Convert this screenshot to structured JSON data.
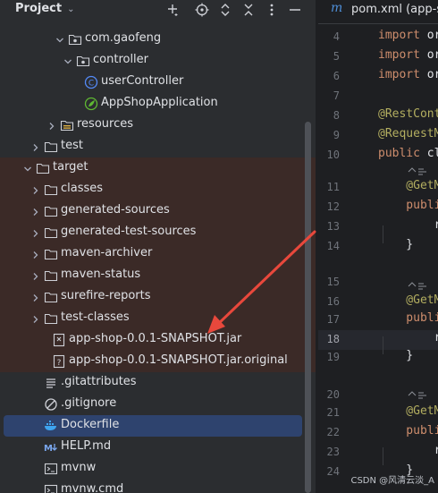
{
  "panel": {
    "title": "Project"
  },
  "tree": [
    {
      "label": "com.gaofeng",
      "type": "package",
      "arrow": "open"
    },
    {
      "label": "controller",
      "type": "package",
      "arrow": "open"
    },
    {
      "label": "userController",
      "type": "class",
      "arrow": "none"
    },
    {
      "label": "AppShopApplication",
      "type": "spring",
      "arrow": "none"
    },
    {
      "label": "resources",
      "type": "resources",
      "arrow": "closed"
    },
    {
      "label": "test",
      "type": "folder",
      "arrow": "closed"
    },
    {
      "label": "target",
      "type": "folder",
      "arrow": "open"
    },
    {
      "label": "classes",
      "type": "folder",
      "arrow": "closed"
    },
    {
      "label": "generated-sources",
      "type": "folder",
      "arrow": "closed"
    },
    {
      "label": "generated-test-sources",
      "type": "folder",
      "arrow": "closed"
    },
    {
      "label": "maven-archiver",
      "type": "folder",
      "arrow": "closed"
    },
    {
      "label": "maven-status",
      "type": "folder",
      "arrow": "closed"
    },
    {
      "label": "surefire-reports",
      "type": "folder",
      "arrow": "closed"
    },
    {
      "label": "test-classes",
      "type": "folder",
      "arrow": "closed"
    },
    {
      "label": "app-shop-0.0.1-SNAPSHOT.jar",
      "type": "jar",
      "arrow": "none"
    },
    {
      "label": "app-shop-0.0.1-SNAPSHOT.jar.original",
      "type": "unknown",
      "arrow": "none"
    },
    {
      "label": ".gitattributes",
      "type": "text",
      "arrow": "none"
    },
    {
      "label": ".gitignore",
      "type": "ignore",
      "arrow": "none"
    },
    {
      "label": "Dockerfile",
      "type": "docker",
      "arrow": "none"
    },
    {
      "label": "HELP.md",
      "type": "markdown",
      "arrow": "none"
    },
    {
      "label": "mvnw",
      "type": "terminal",
      "arrow": "none"
    },
    {
      "label": "mvnw.cmd",
      "type": "terminal",
      "arrow": "none"
    }
  ],
  "editor": {
    "tab_icon": "m",
    "tab_label": "pom.xml (app-sh",
    "lines": [
      {
        "n": "4",
        "segs": [
          [
            "kw",
            "import "
          ],
          [
            "",
            "or"
          ]
        ]
      },
      {
        "n": "5",
        "segs": [
          [
            "kw",
            "import "
          ],
          [
            "",
            "or"
          ]
        ]
      },
      {
        "n": "6",
        "segs": [
          [
            "kw",
            "import "
          ],
          [
            "",
            "or"
          ]
        ]
      },
      {
        "n": "7",
        "segs": []
      },
      {
        "n": "8",
        "segs": [
          [
            "ann",
            "@RestCont"
          ]
        ]
      },
      {
        "n": "9",
        "segs": [
          [
            "ann",
            "@RequestM"
          ]
        ]
      },
      {
        "n": "10",
        "segs": [
          [
            "kw",
            "public "
          ],
          [
            "",
            "cl"
          ]
        ]
      },
      {
        "n": "11",
        "segs": [
          [
            "ann",
            "    @GetM"
          ]
        ]
      },
      {
        "n": "12",
        "segs": [
          [
            "kw",
            "    publi"
          ]
        ]
      },
      {
        "n": "13",
        "segs": [
          [
            "",
            "        r"
          ]
        ]
      },
      {
        "n": "14",
        "segs": [
          [
            "",
            "    }"
          ]
        ]
      },
      {
        "n": "15",
        "segs": []
      },
      {
        "n": "16",
        "segs": [
          [
            "ann",
            "    @GetM"
          ]
        ]
      },
      {
        "n": "17",
        "segs": [
          [
            "kw",
            "    publi"
          ]
        ]
      },
      {
        "n": "18",
        "segs": [
          [
            "",
            "        r"
          ]
        ]
      },
      {
        "n": "19",
        "segs": [
          [
            "",
            "    }"
          ]
        ]
      },
      {
        "n": "20",
        "segs": []
      },
      {
        "n": "21",
        "segs": [
          [
            "ann",
            "    @GetM"
          ]
        ]
      },
      {
        "n": "22",
        "segs": [
          [
            "kw",
            "    publi"
          ]
        ]
      },
      {
        "n": "23",
        "segs": [
          [
            "",
            "        r"
          ]
        ]
      },
      {
        "n": "24",
        "segs": [
          [
            "",
            "    }"
          ]
        ]
      }
    ],
    "current_line": "18"
  },
  "watermark": "CSDN @风清云淡_A",
  "colors": {
    "panel_bg": "#2b2d30",
    "editor_bg": "#1e1f22",
    "highlight": "#3b2a27",
    "selection": "#2e436e",
    "keyword": "#cf8e6d",
    "annotation": "#b3ae60",
    "arrow": "#e8483c"
  }
}
